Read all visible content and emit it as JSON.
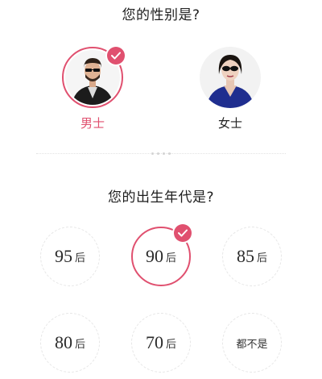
{
  "gender_section": {
    "title": "您的性别是?",
    "options": [
      {
        "label": "男士",
        "selected": true
      },
      {
        "label": "女士",
        "selected": false
      }
    ]
  },
  "era_section": {
    "title": "您的出生年代是?",
    "options": [
      {
        "num": "95",
        "suffix": "后",
        "selected": false
      },
      {
        "num": "90",
        "suffix": "后",
        "selected": true
      },
      {
        "num": "85",
        "suffix": "后",
        "selected": false
      },
      {
        "num": "80",
        "suffix": "后",
        "selected": false
      },
      {
        "num": "70",
        "suffix": "后",
        "selected": false
      },
      {
        "full": "都不是",
        "selected": false
      }
    ]
  },
  "colors": {
    "accent": "#e0506f",
    "border": "#e6e6e6",
    "text": "#222222"
  },
  "icons": {
    "selected": "check-icon"
  }
}
